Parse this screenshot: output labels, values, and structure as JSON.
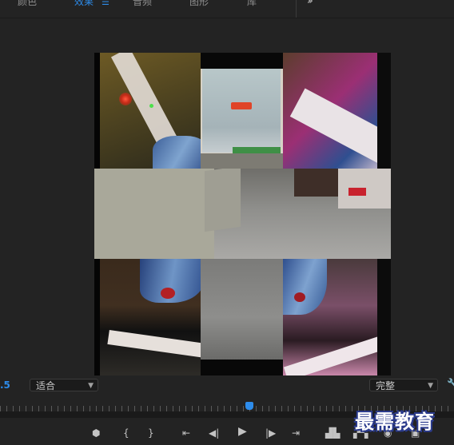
{
  "tabs": [
    {
      "label": "颜色",
      "active": false
    },
    {
      "label": "效果",
      "active": true,
      "menu_icon": "hamburger-menu-icon"
    },
    {
      "label": "音频",
      "active": false
    },
    {
      "label": "图形",
      "active": false
    },
    {
      "label": "库",
      "active": false
    }
  ],
  "overflow_icon": "double-chevron-right-icon",
  "controls": {
    "timecode_fragment": ".5",
    "zoom": {
      "value": "适合",
      "icon": "chevron-down-icon"
    },
    "quality": {
      "value": "完整",
      "icon": "chevron-down-icon"
    },
    "settings_icon": "wrench-icon"
  },
  "ruler": {
    "playhead_fraction": 0.55
  },
  "transport_icons": [
    "marker-icon",
    "mark-in-icon",
    "mark-out-icon",
    "go-to-in-icon",
    "step-back-icon",
    "play-icon",
    "step-forward-icon",
    "go-to-out-icon",
    "lift-icon",
    "extract-icon",
    "camera-icon",
    "compare-icon"
  ],
  "transport_glyphs": {
    "marker": "⬢",
    "mark_in": "{",
    "mark_out": "}",
    "go_to_in": "⇤",
    "step_back": "◀|",
    "play": "▶",
    "step_forward": "|▶",
    "go_to_out": "⇥",
    "lift": "▟▙",
    "extract": "▞▚",
    "camera": "◉",
    "compare": "▣"
  },
  "watermark": "最需教育"
}
